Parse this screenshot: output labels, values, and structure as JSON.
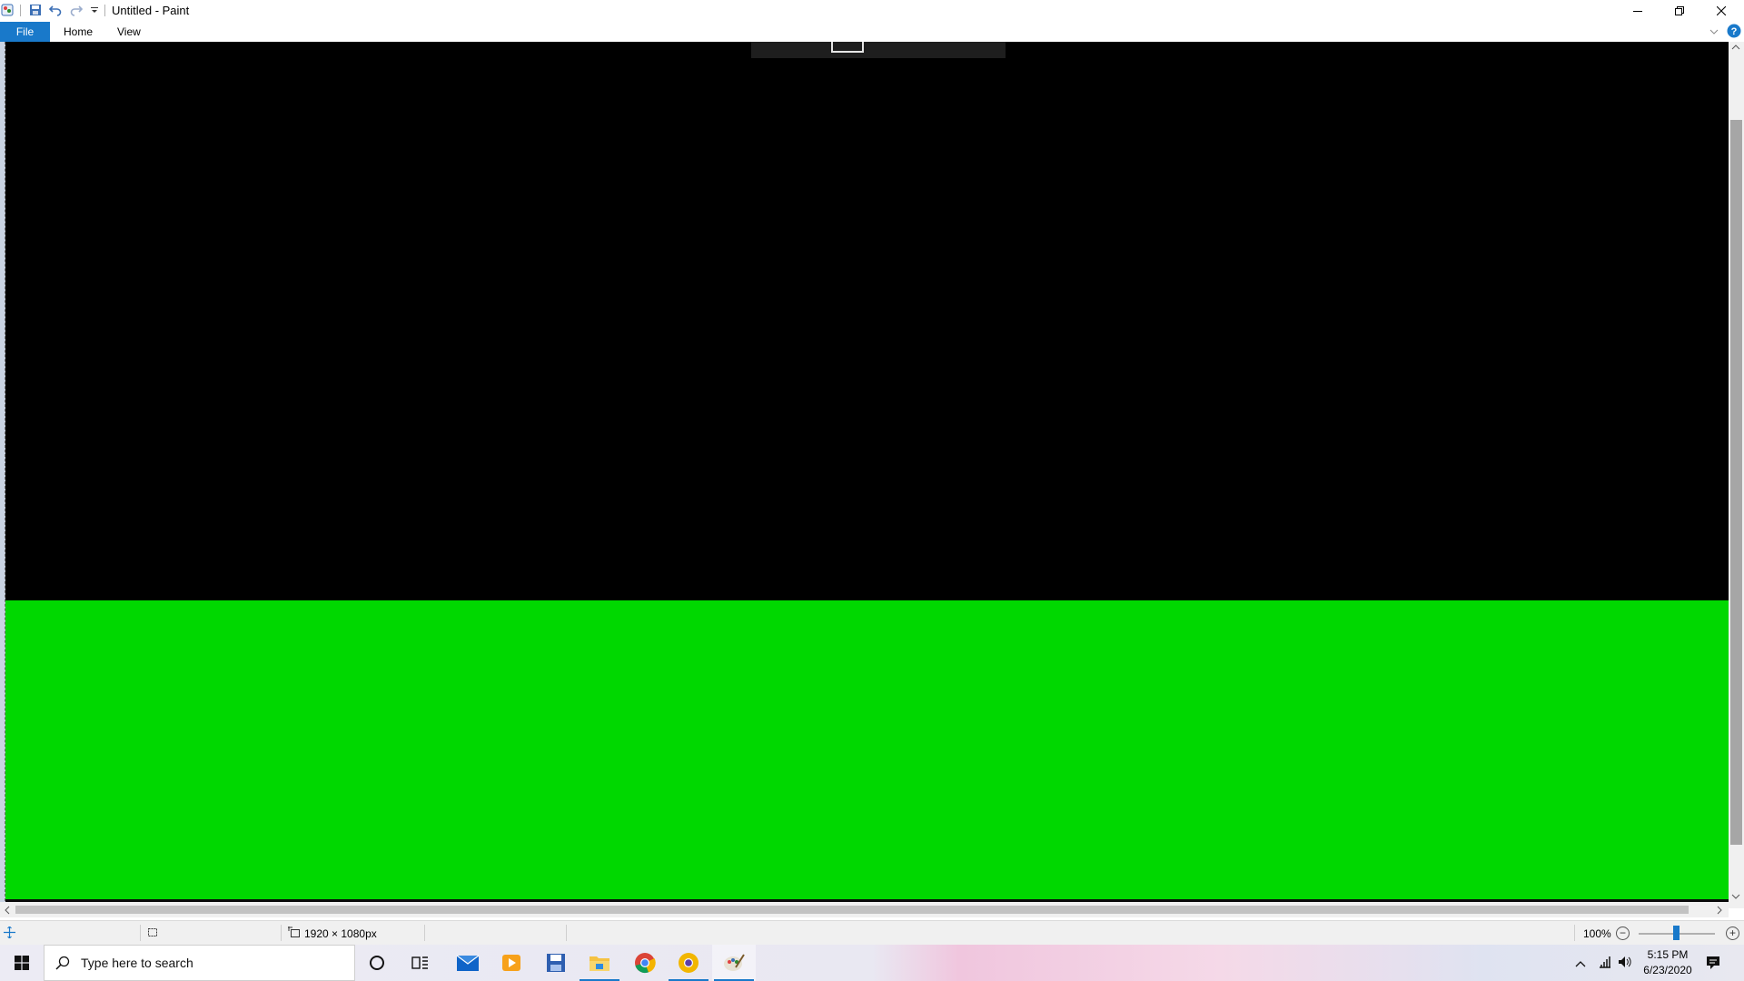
{
  "window": {
    "title": "Untitled - Paint"
  },
  "ribbon": {
    "tabs": [
      {
        "label": "File"
      },
      {
        "label": "Home"
      },
      {
        "label": "View"
      }
    ]
  },
  "canvas": {
    "top_color": "#000000",
    "bottom_color": "#00d800"
  },
  "statusbar": {
    "dimensions": "1920 × 1080px",
    "zoom_label": "100%",
    "zoom_level_percent": 100
  },
  "taskbar": {
    "search_placeholder": "Type here to search",
    "apps": [
      {
        "icon": "cortana-icon"
      },
      {
        "icon": "task-view-icon"
      },
      {
        "icon": "mail-icon"
      },
      {
        "icon": "media-player-icon"
      },
      {
        "icon": "save-disk-app-icon"
      },
      {
        "icon": "file-explorer-icon",
        "active": true
      },
      {
        "icon": "chrome-icon"
      },
      {
        "icon": "chrome-canary-icon",
        "active": true
      },
      {
        "icon": "paint-icon",
        "active": true
      }
    ],
    "time": "5:15 PM",
    "date": "6/23/2020"
  },
  "colors": {
    "accent": "#1979ca"
  }
}
